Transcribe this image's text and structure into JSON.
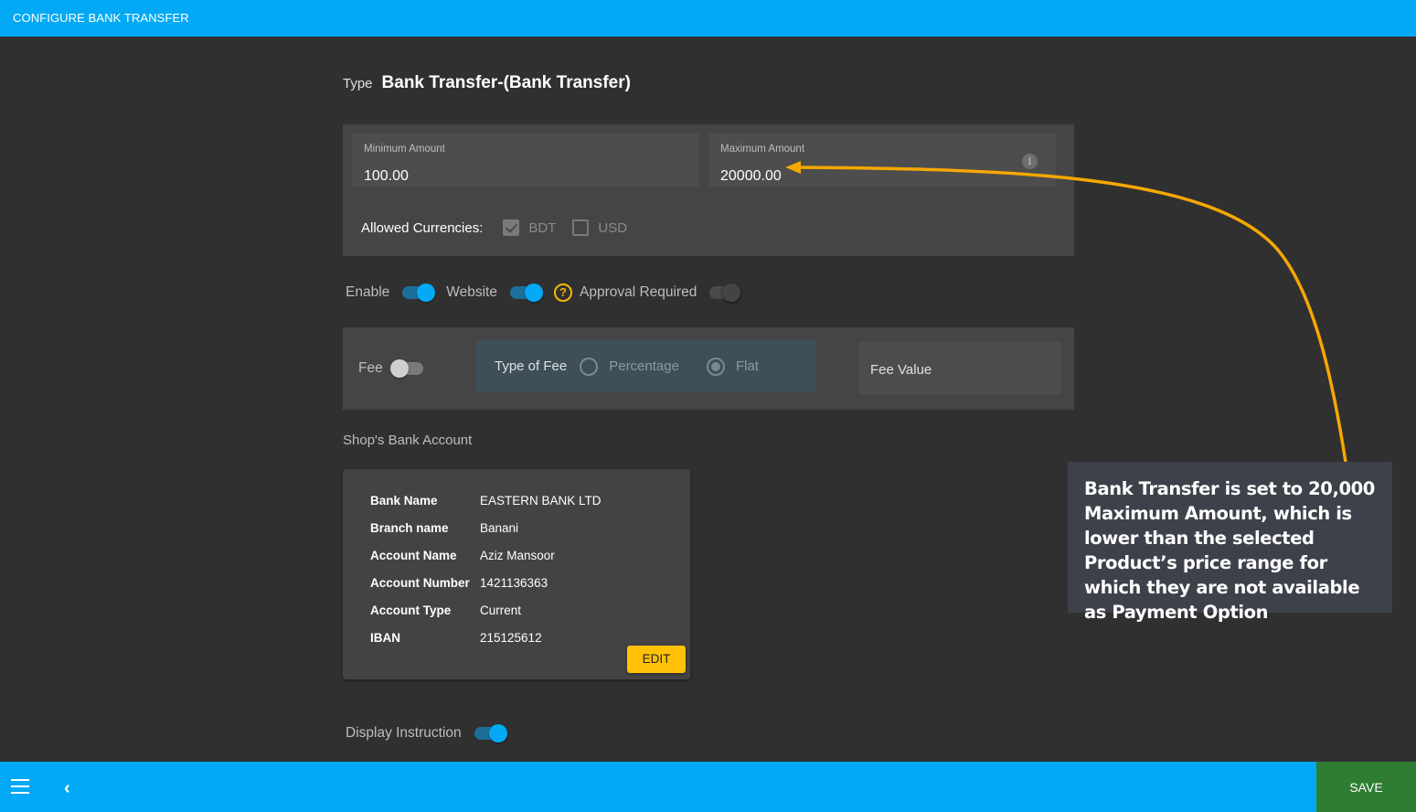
{
  "header": {
    "title": "CONFIGURE BANK TRANSFER"
  },
  "type": {
    "label": "Type",
    "value": "Bank Transfer-(Bank Transfer)"
  },
  "amounts": {
    "minimum_label": "Minimum Amount",
    "minimum_value": "100.00",
    "maximum_label": "Maximum Amount",
    "maximum_value": "20000.00",
    "info_icon": "i"
  },
  "currencies": {
    "label": "Allowed Currencies:",
    "options": [
      {
        "code": "BDT",
        "checked": true
      },
      {
        "code": "USD",
        "checked": false
      }
    ]
  },
  "toggles": {
    "enable_label": "Enable",
    "enable_on": true,
    "website_label": "Website",
    "website_on": true,
    "approval_label": "Approval Required",
    "approval_on": false,
    "help_icon": "?"
  },
  "fee": {
    "label": "Fee",
    "enabled": false,
    "type_label": "Type of Fee",
    "options": [
      "Percentage",
      "Flat"
    ],
    "selected": "Flat",
    "value_label": "Fee Value"
  },
  "bank_account": {
    "title": "Shop's Bank Account",
    "rows": [
      {
        "key": "Bank Name",
        "value": "EASTERN BANK LTD"
      },
      {
        "key": "Branch name",
        "value": "Banani"
      },
      {
        "key": "Account Name",
        "value": "Aziz Mansoor"
      },
      {
        "key": "Account Number",
        "value": "1421136363"
      },
      {
        "key": "Account Type",
        "value": "Current"
      },
      {
        "key": "IBAN",
        "value": "215125612"
      }
    ],
    "edit_label": "EDIT"
  },
  "display_instruction": {
    "label": "Display Instruction",
    "on": true
  },
  "footer": {
    "save_label": "SAVE",
    "back_icon": "‹"
  },
  "annotation": {
    "text": "Bank Transfer is set to 20,000 Maximum Amount, which is lower than the selected Product’s price range for which they are not available as Payment Option",
    "color": "#f5a800"
  },
  "colors": {
    "primary": "#03a9f4",
    "save": "#2e7d32",
    "edit": "#ffc107"
  }
}
